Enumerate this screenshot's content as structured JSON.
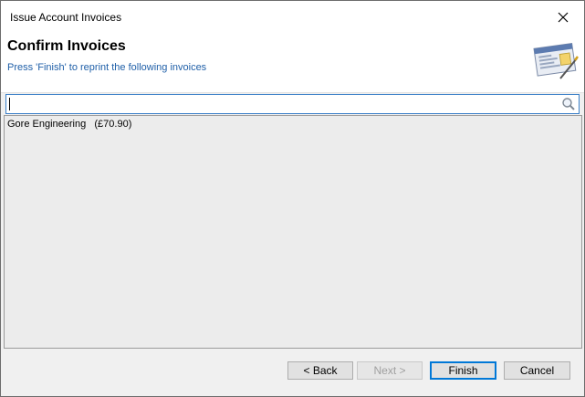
{
  "window": {
    "title": "Issue Account Invoices"
  },
  "header": {
    "title": "Confirm Invoices",
    "subtitle": "Press 'Finish' to reprint the following invoices",
    "icon": "invoice-document-icon"
  },
  "search": {
    "value": "",
    "placeholder": "",
    "icon": "search-icon"
  },
  "invoices": [
    {
      "label": "Gore Engineering   (£70.90)"
    }
  ],
  "buttons": {
    "back": "< Back",
    "next": "Next >",
    "finish": "Finish",
    "cancel": "Cancel"
  },
  "colors": {
    "subtitle": "#1f5fa8",
    "focus_border": "#3a7fc8",
    "default_button_border": "#0078d7"
  }
}
